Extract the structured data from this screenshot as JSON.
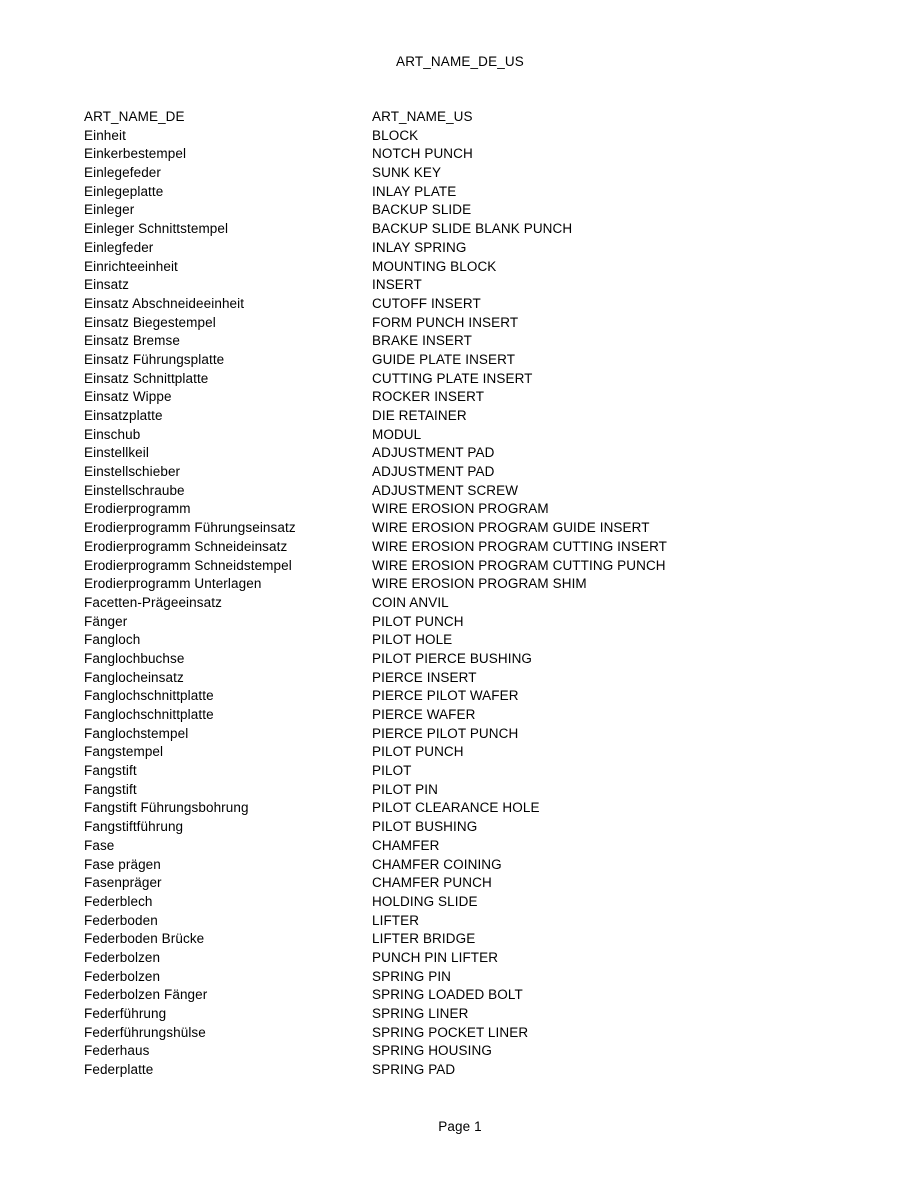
{
  "document": {
    "title": "ART_NAME_DE_US",
    "footer": "Page 1"
  },
  "table": {
    "columns": [
      "ART_NAME_DE",
      "ART_NAME_US"
    ],
    "rows": [
      [
        "Einheit",
        "BLOCK"
      ],
      [
        "Einkerbestempel",
        "NOTCH PUNCH"
      ],
      [
        "Einlegefeder",
        "SUNK KEY"
      ],
      [
        "Einlegeplatte",
        "INLAY PLATE"
      ],
      [
        "Einleger",
        "BACKUP SLIDE"
      ],
      [
        "Einleger Schnittstempel",
        "BACKUP SLIDE BLANK PUNCH"
      ],
      [
        "Einlegfeder",
        "INLAY SPRING"
      ],
      [
        "Einrichteeinheit",
        "MOUNTING BLOCK"
      ],
      [
        "Einsatz",
        "INSERT"
      ],
      [
        "Einsatz Abschneideeinheit",
        "CUTOFF INSERT"
      ],
      [
        "Einsatz Biegestempel",
        "FORM PUNCH INSERT"
      ],
      [
        "Einsatz Bremse",
        "BRAKE INSERT"
      ],
      [
        "Einsatz Führungsplatte",
        "GUIDE PLATE INSERT"
      ],
      [
        "Einsatz Schnittplatte",
        "CUTTING PLATE INSERT"
      ],
      [
        "Einsatz Wippe",
        "ROCKER INSERT"
      ],
      [
        "Einsatzplatte",
        "DIE RETAINER"
      ],
      [
        "Einschub",
        "MODUL"
      ],
      [
        "Einstellkeil",
        "ADJUSTMENT PAD"
      ],
      [
        "Einstellschieber",
        "ADJUSTMENT PAD"
      ],
      [
        "Einstellschraube",
        "ADJUSTMENT SCREW"
      ],
      [
        "Erodierprogramm",
        "WIRE EROSION PROGRAM"
      ],
      [
        "Erodierprogramm Führungseinsatz",
        "WIRE EROSION PROGRAM GUIDE INSERT"
      ],
      [
        "Erodierprogramm Schneideinsatz",
        "WIRE EROSION PROGRAM CUTTING INSERT"
      ],
      [
        "Erodierprogramm Schneidstempel",
        "WIRE EROSION PROGRAM CUTTING PUNCH"
      ],
      [
        "Erodierprogramm Unterlagen",
        "WIRE EROSION PROGRAM SHIM"
      ],
      [
        "Facetten-Prägeeinsatz",
        "COIN ANVIL"
      ],
      [
        "Fänger",
        "PILOT PUNCH"
      ],
      [
        "Fangloch",
        "PILOT HOLE"
      ],
      [
        "Fanglochbuchse",
        "PILOT PIERCE BUSHING"
      ],
      [
        "Fanglocheinsatz",
        "PIERCE INSERT"
      ],
      [
        "Fanglochschnittplatte",
        "PIERCE PILOT WAFER"
      ],
      [
        "Fanglochschnittplatte",
        "PIERCE WAFER"
      ],
      [
        "Fanglochstempel",
        "PIERCE PILOT PUNCH"
      ],
      [
        "Fangstempel",
        "PILOT PUNCH"
      ],
      [
        "Fangstift",
        "PILOT"
      ],
      [
        "Fangstift",
        "PILOT PIN"
      ],
      [
        "Fangstift Führungsbohrung",
        "PILOT CLEARANCE HOLE"
      ],
      [
        "Fangstiftführung",
        "PILOT BUSHING"
      ],
      [
        "Fase",
        "CHAMFER"
      ],
      [
        "Fase prägen",
        "CHAMFER COINING"
      ],
      [
        "Fasenpräger",
        "CHAMFER PUNCH"
      ],
      [
        "Federblech",
        "HOLDING SLIDE"
      ],
      [
        "Federboden",
        "LIFTER"
      ],
      [
        "Federboden Brücke",
        "LIFTER BRIDGE"
      ],
      [
        "Federbolzen",
        "PUNCH PIN LIFTER"
      ],
      [
        "Federbolzen",
        "SPRING PIN"
      ],
      [
        "Federbolzen Fänger",
        "SPRING LOADED BOLT"
      ],
      [
        "Federführung",
        "SPRING LINER"
      ],
      [
        "Federführungshülse",
        "SPRING POCKET LINER"
      ],
      [
        "Federhaus",
        "SPRING HOUSING"
      ],
      [
        "Federplatte",
        "SPRING PAD"
      ]
    ]
  }
}
